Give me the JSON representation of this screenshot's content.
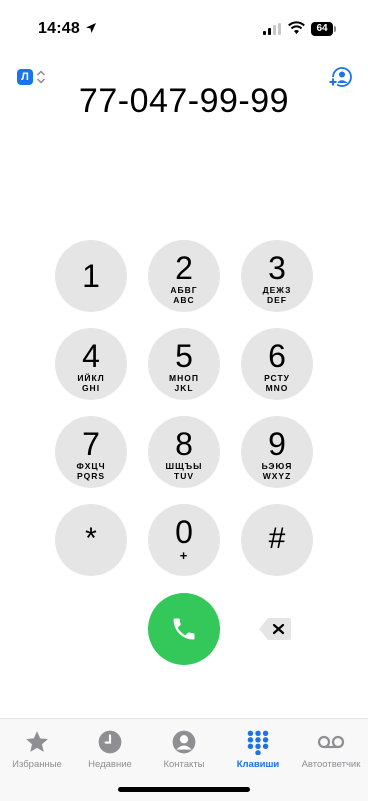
{
  "status_bar": {
    "time": "14:48",
    "battery": "64"
  },
  "sim": {
    "label": "Л"
  },
  "dialed_number": "77-047-99-99",
  "keypad": [
    {
      "digit": "1",
      "line1": "",
      "line2": ""
    },
    {
      "digit": "2",
      "line1": "АБВГ",
      "line2": "ABC"
    },
    {
      "digit": "3",
      "line1": "ДЕЖЗ",
      "line2": "DEF"
    },
    {
      "digit": "4",
      "line1": "ИЙКЛ",
      "line2": "GHI"
    },
    {
      "digit": "5",
      "line1": "МНОП",
      "line2": "JKL"
    },
    {
      "digit": "6",
      "line1": "РСТУ",
      "line2": "MNO"
    },
    {
      "digit": "7",
      "line1": "ФХЦЧ",
      "line2": "PQRS"
    },
    {
      "digit": "8",
      "line1": "ШЩЪЫ",
      "line2": "TUV"
    },
    {
      "digit": "9",
      "line1": "ЬЭЮЯ",
      "line2": "WXYZ"
    },
    {
      "digit": "*",
      "line1": "",
      "line2": ""
    },
    {
      "digit": "0",
      "line1": "+",
      "line2": ""
    },
    {
      "digit": "#",
      "line1": "",
      "line2": ""
    }
  ],
  "tabs": [
    {
      "label": "Избранные",
      "icon": "star-icon",
      "active": false
    },
    {
      "label": "Недавние",
      "icon": "clock-icon",
      "active": false
    },
    {
      "label": "Контакты",
      "icon": "contact-icon",
      "active": false
    },
    {
      "label": "Клавиши",
      "icon": "keypad-icon",
      "active": true
    },
    {
      "label": "Автоответчик",
      "icon": "voicemail-icon",
      "active": false
    }
  ],
  "colors": {
    "accent": "#1a73e8",
    "call": "#34c759",
    "key_bg": "#e5e5e5",
    "inactive": "#8e8e93"
  }
}
